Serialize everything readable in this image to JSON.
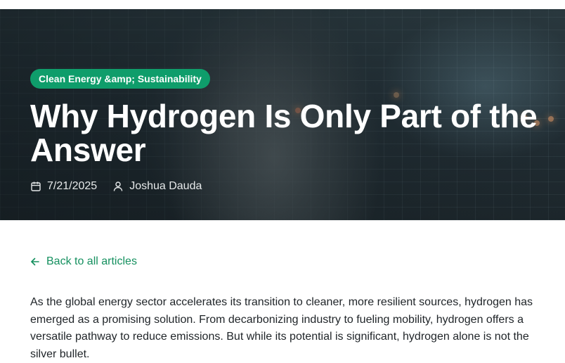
{
  "article": {
    "category": "Clean Energy &amp; Sustainability",
    "title": "Why Hydrogen Is Only Part of the Answer",
    "date": "7/21/2025",
    "author": "Joshua Dauda"
  },
  "nav": {
    "back_label": "Back to all articles"
  },
  "body": {
    "lines": [
      "As the global energy sector accelerates its transition to cleaner, more resilient sources, hydrogen has",
      "emerged as a promising solution. From decarbonizing industry to fueling mobility, hydrogen offers a",
      "versatile pathway to reduce emissions. But while its potential is significant, hydrogen alone is not the",
      "silver bullet."
    ]
  },
  "icons": {
    "date": "calendar-icon",
    "author": "user-icon",
    "back": "arrow-left-icon"
  },
  "colors": {
    "accent": "#0f9d6b",
    "link": "#15905f",
    "text": "#1f2428"
  }
}
